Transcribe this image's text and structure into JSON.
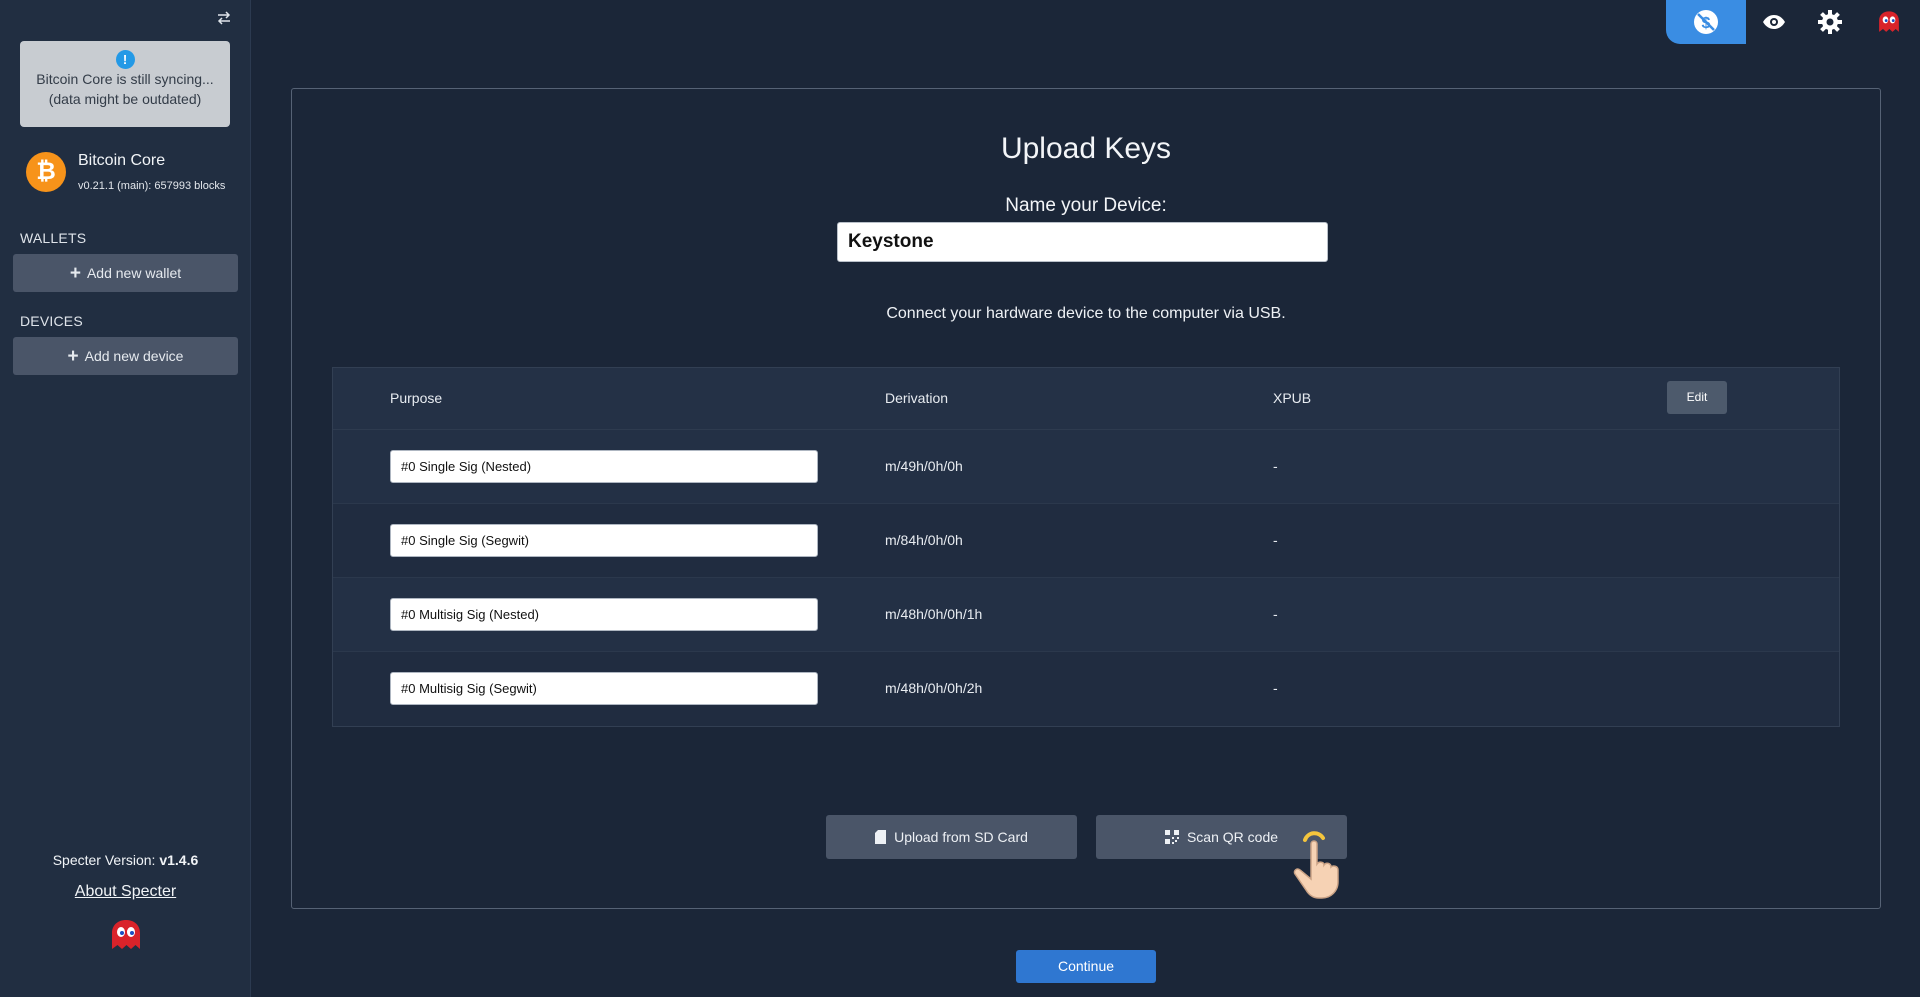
{
  "sidebar": {
    "sync_notice": {
      "line1": "Bitcoin Core is still syncing...",
      "line2": "(data might be outdated)"
    },
    "node": {
      "name": "Bitcoin Core",
      "info": "v0.21.1 (main): 657993 blocks"
    },
    "wallets": {
      "title": "WALLETS",
      "add_label": "Add new wallet"
    },
    "devices": {
      "title": "DEVICES",
      "add_label": "Add new device"
    },
    "version_label": "Specter Version:",
    "version_value": "v1.4.6",
    "about_label": "About Specter"
  },
  "toolbar": {
    "icons": [
      "price-hidden-icon",
      "eye-icon",
      "gear-icon",
      "ghost-icon"
    ],
    "accent": "#3a8de3"
  },
  "main": {
    "title": "Upload Keys",
    "name_label": "Name your Device:",
    "device_name": "Keystone",
    "connect_text": "Connect your hardware device to the computer via USB.",
    "table": {
      "headers": {
        "purpose": "Purpose",
        "derivation": "Derivation",
        "xpub": "XPUB"
      },
      "edit_label": "Edit",
      "rows": [
        {
          "purpose": "#0 Single Sig (Nested)",
          "derivation": "m/49h/0h/0h",
          "xpub": "-"
        },
        {
          "purpose": "#0 Single Sig (Segwit)",
          "derivation": "m/84h/0h/0h",
          "xpub": "-"
        },
        {
          "purpose": "#0 Multisig Sig (Nested)",
          "derivation": "m/48h/0h/0h/1h",
          "xpub": "-"
        },
        {
          "purpose": "#0 Multisig Sig (Segwit)",
          "derivation": "m/48h/0h/0h/2h",
          "xpub": "-"
        }
      ]
    },
    "upload_sd_label": "Upload from SD Card",
    "scan_qr_label": "Scan QR code",
    "continue_label": "Continue"
  },
  "colors": {
    "background": "#1b2638",
    "sidebar": "#212e41",
    "button": "#4a5568",
    "primary": "#2f77d1",
    "bitcoin": "#f7931a"
  }
}
